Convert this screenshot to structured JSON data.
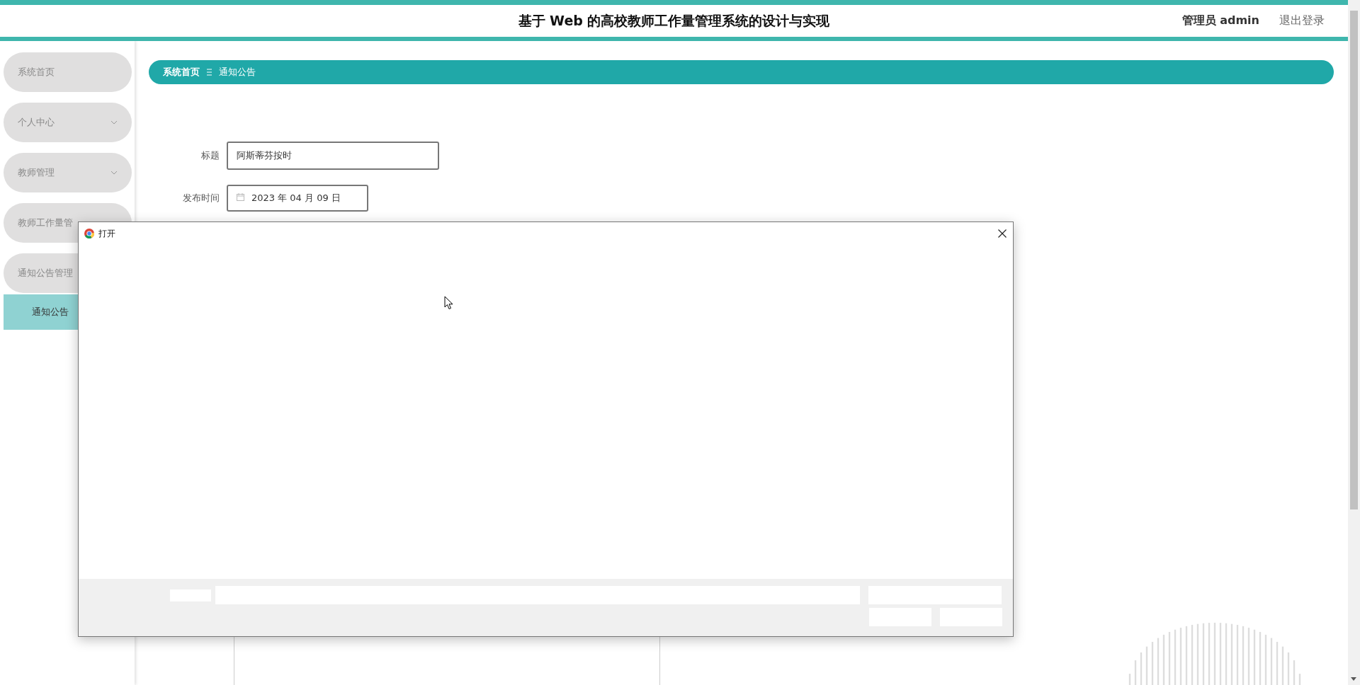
{
  "header": {
    "title": "基于 Web 的高校教师工作量管理系统的设计与实现",
    "user": "管理员 admin",
    "logout": "退出登录"
  },
  "sidebar": {
    "items": [
      {
        "label": "系统首页",
        "selected": false
      },
      {
        "label": "个人中心",
        "selected": false,
        "expanded": false
      },
      {
        "label": "教师管理",
        "selected": false,
        "expanded": false
      },
      {
        "label": "教师工作量管",
        "selected": false
      },
      {
        "label": "通知公告管理",
        "selected": false,
        "children": [
          {
            "label": "通知公告",
            "selected": true
          }
        ]
      }
    ]
  },
  "breadcrumb": [
    "系统首页",
    "通知公告"
  ],
  "form": {
    "fields": [
      {
        "label": "标题",
        "kind": "text",
        "value": "阿斯蒂芬按时"
      },
      {
        "label": "发布时间",
        "kind": "date",
        "value": "2023 年 04 月 09 日"
      }
    ]
  },
  "dialog": {
    "title": "打开"
  }
}
